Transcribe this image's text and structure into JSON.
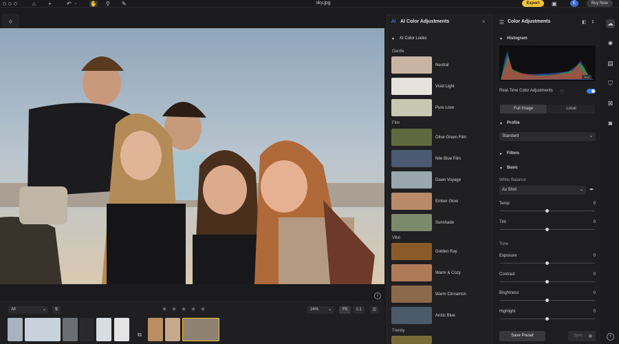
{
  "app": {
    "file_title": "sky.jpg",
    "export_label": "Export",
    "avatar_initial": "E",
    "buy_now_label": "Buy Now"
  },
  "bottom": {
    "filter": "All",
    "zoom": "24%",
    "fit_label": "Fit",
    "one_label": "1:1",
    "rating_stars": 5
  },
  "ai_panel": {
    "title": "AI Color Adjustments",
    "looks_header": "AI Color Looks",
    "groups": [
      {
        "name": "Gentle",
        "items": [
          "Neutral",
          "Vivid Light",
          "Pure Love"
        ]
      },
      {
        "name": "Film",
        "items": [
          "Olive Green Film",
          "Nile Blue Film",
          "Dawn Voyage",
          "Ember Glow",
          "Sunshade"
        ]
      },
      {
        "name": "Vibe",
        "items": [
          "Golden Ray",
          "Warm & Cozy",
          "Warm Cinnamon",
          "Arctic Blue"
        ]
      },
      {
        "name": "Trendy",
        "items": []
      }
    ]
  },
  "color_panel": {
    "title": "Color Adjustments",
    "histogram_label": "Histogram",
    "histogram_badge": "JPG",
    "realtime_label": "Real-Time Color Adjustments",
    "realtime_on": true,
    "seg_full": "Full Image",
    "seg_local": "Local",
    "profile_label": "Profile",
    "profile_value": "Standard",
    "filters_label": "Filters",
    "basic_label": "Basic",
    "white_balance_label": "White Balance",
    "white_balance_value": "As Shot",
    "temp_label": "Temp",
    "temp_value": "0",
    "tint_label": "Tint",
    "tint_value": "0",
    "tone_label": "Tone",
    "exposure_label": "Exposure",
    "exposure_value": "0",
    "contrast_label": "Contrast",
    "contrast_value": "0",
    "brightness_label": "Brightness",
    "brightness_value": "0",
    "highlight_label": "Highlight",
    "highlight_value": "0",
    "save_preset_label": "Save Preset",
    "sync_label": "Sync"
  },
  "colors": {
    "accent_export": "#f3c33a",
    "toggle_on": "#3c7bf0",
    "avatar": "#3b6fd8"
  }
}
